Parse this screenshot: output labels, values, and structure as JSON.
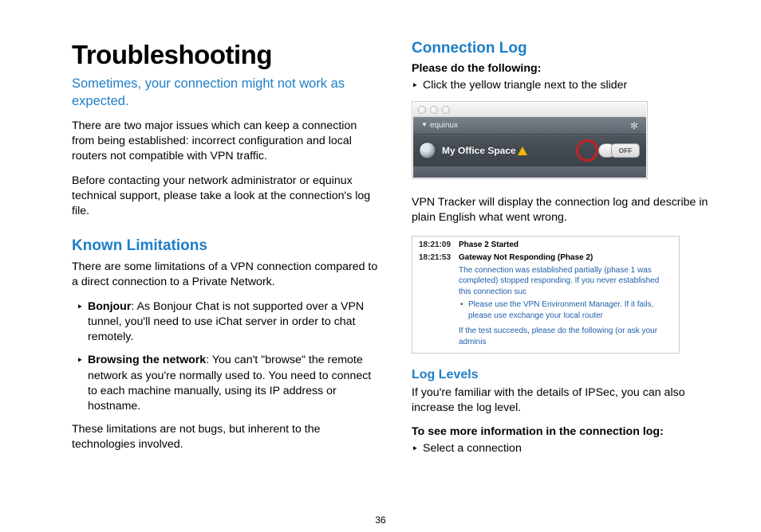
{
  "page_number": "36",
  "left": {
    "title": "Troubleshooting",
    "subtitle": "Sometimes, your connection might not work as expected.",
    "intro1": "There are two major issues which can keep a connection from being established: incorrect configuration and local routers not compatible with VPN traffic.",
    "intro2": "Before contacting your network administrator or equinux technical support, please take a look at the connection's log file.",
    "known_h": "Known Limitations",
    "known_p": "There are some limitations of a VPN connection compared to a direct connection to a Private Network.",
    "b1_title": "Bonjour",
    "b1_text": ": As Bonjour Chat is not supported over a VPN tunnel, you'll need to use iChat server in order to chat remotely.",
    "b2_title": "Browsing the network",
    "b2_text": ": You can't \"browse\" the remote network as you're normally used to. You need to connect to each machine manually, using its IP address or hostname.",
    "known_end": "These limitations are not bugs, but inherent to the technologies involved."
  },
  "right": {
    "conn_h": "Connection Log",
    "conn_intro": "Please do the following:",
    "conn_step": "Click the yellow triangle next to the slider",
    "app": {
      "brand": "equinux",
      "conn_name": "My Office Space",
      "off_label": "OFF"
    },
    "conn_after": "VPN Tracker will display the connection log and describe in plain English what went wrong.",
    "log": {
      "t1": "18:21:09",
      "l1": "Phase 2 Started",
      "t2": "18:21:53",
      "l2": "Gateway Not Responding (Phase 2)",
      "sub": "The connection was established partially (phase 1 was completed) stopped responding. If you never established this connection suc",
      "li1a": "Please use the ",
      "li1link": "VPN Environment Manager",
      "li1b": ". If it fails, please use exchange your local router",
      "li2": "If the test succeeds, please do the following (or ask your adminis"
    },
    "levels_h": "Log Levels",
    "levels_p": "If you're familiar with the details of IPSec, you can also increase the log level.",
    "levels_bold": "To see more information in the connection log:",
    "levels_step": "Select a connection"
  }
}
